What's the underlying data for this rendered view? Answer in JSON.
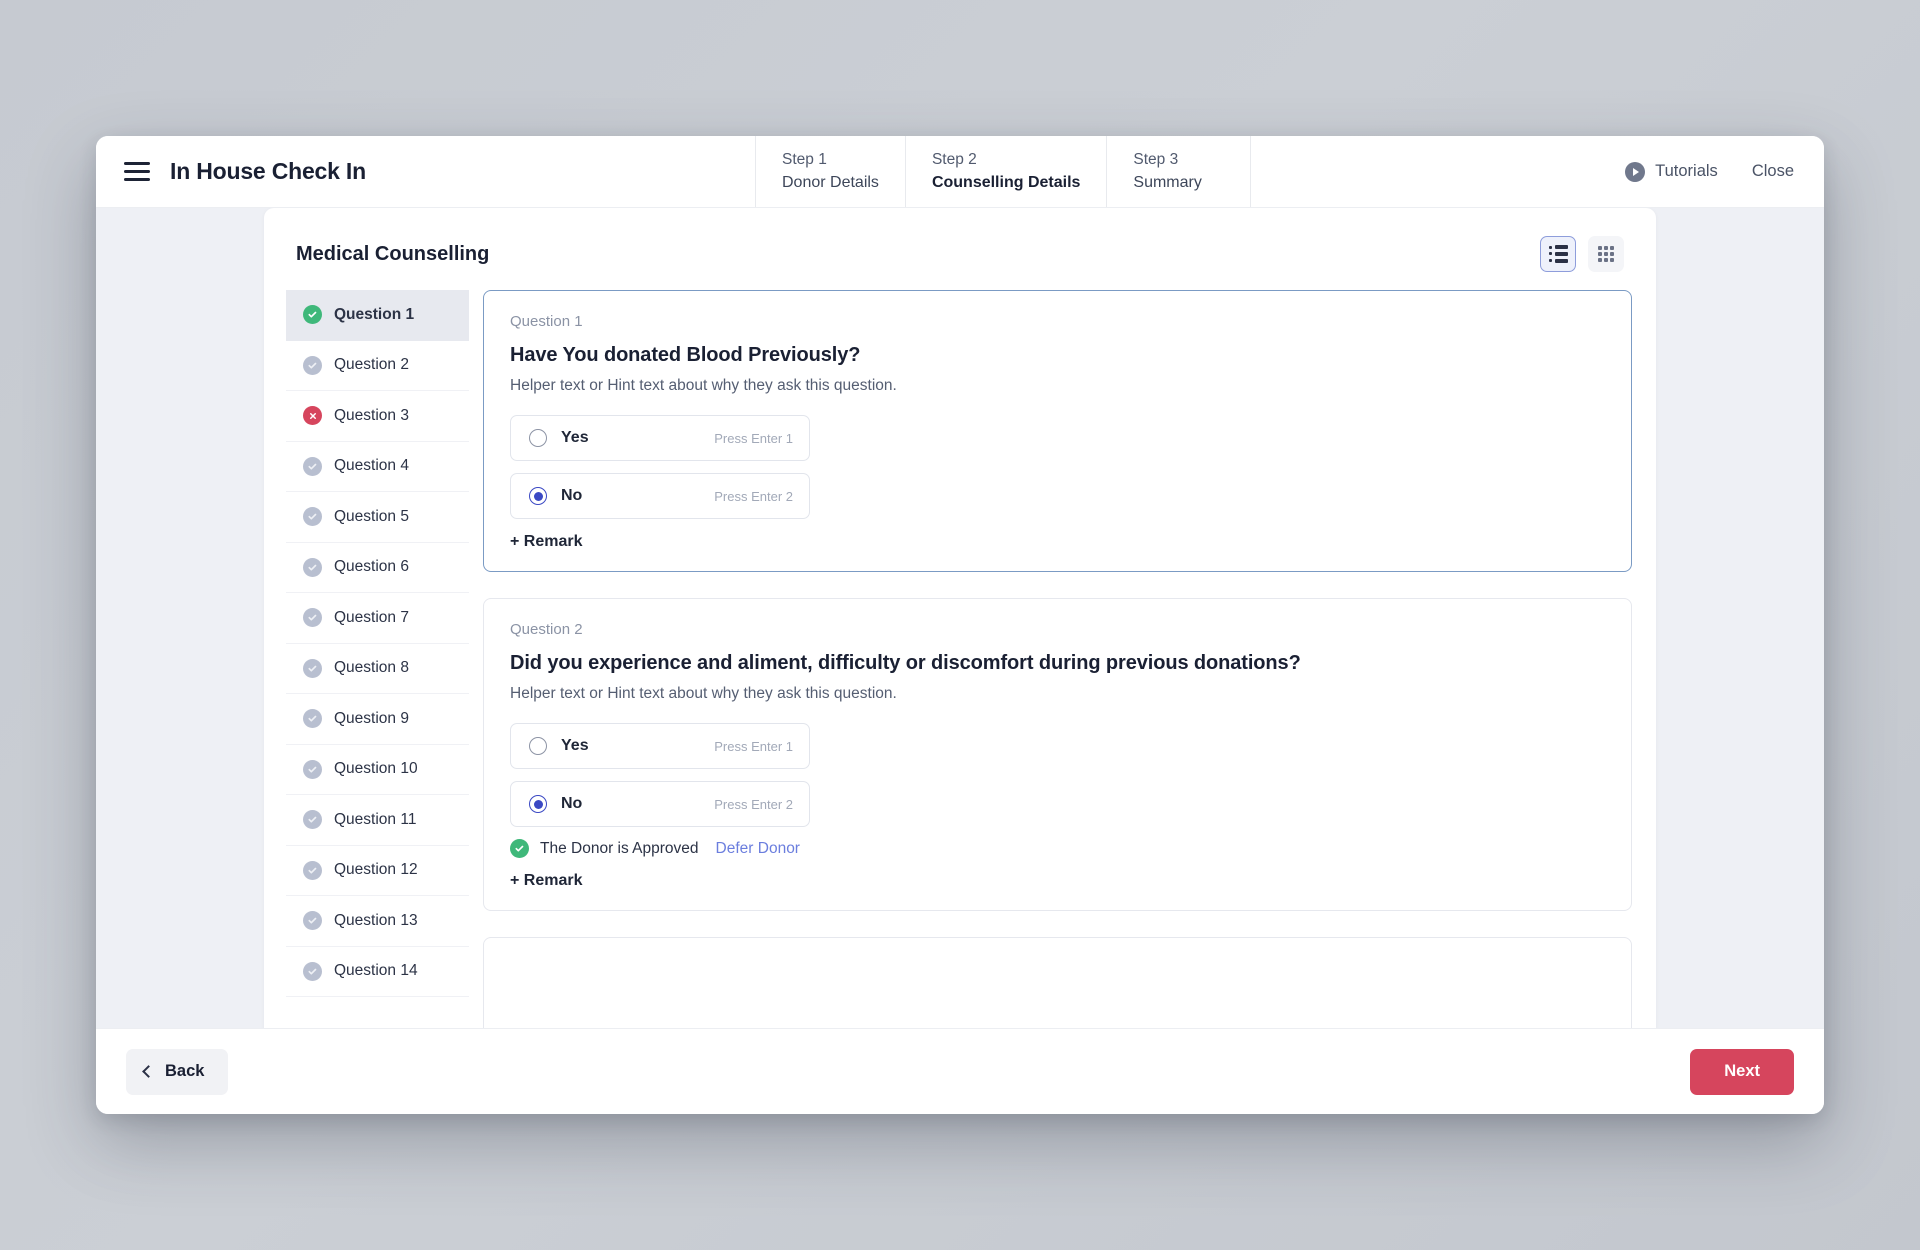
{
  "header": {
    "menu_icon": "hamburger-icon",
    "app_title": "In House Check In",
    "steps": [
      {
        "number": "Step 1",
        "label": "Donor Details",
        "active": false
      },
      {
        "number": "Step 2",
        "label": "Counselling Details",
        "active": true
      },
      {
        "number": "Step 3",
        "label": "Summary",
        "active": false
      }
    ],
    "tutorials_label": "Tutorials",
    "tutorials_icon": "play-circle-icon",
    "close_label": "Close"
  },
  "panel": {
    "title": "Medical Counselling",
    "view_toggle": {
      "list_icon": "list-view-icon",
      "grid_icon": "grid-view-icon",
      "active": "list"
    }
  },
  "sidebar": {
    "items": [
      {
        "label": "Question 1",
        "status": "ok",
        "active": true
      },
      {
        "label": "Question 2",
        "status": "mut",
        "active": false
      },
      {
        "label": "Question 3",
        "status": "err",
        "active": false
      },
      {
        "label": "Question 4",
        "status": "mut",
        "active": false
      },
      {
        "label": "Question 5",
        "status": "mut",
        "active": false
      },
      {
        "label": "Question 6",
        "status": "mut",
        "active": false
      },
      {
        "label": "Question 7",
        "status": "mut",
        "active": false
      },
      {
        "label": "Question 8",
        "status": "mut",
        "active": false
      },
      {
        "label": "Question 9",
        "status": "mut",
        "active": false
      },
      {
        "label": "Question 10",
        "status": "mut",
        "active": false
      },
      {
        "label": "Question 11",
        "status": "mut",
        "active": false
      },
      {
        "label": "Question 12",
        "status": "mut",
        "active": false
      },
      {
        "label": "Question 13",
        "status": "mut",
        "active": false
      },
      {
        "label": "Question 14",
        "status": "mut",
        "active": false
      }
    ]
  },
  "questions": [
    {
      "index_label": "Question 1",
      "text": "Have You donated Blood Previously?",
      "hint": "Helper text or Hint text about why they ask this question.",
      "active": true,
      "options": [
        {
          "label": "Yes",
          "hint": "Press Enter 1",
          "selected": false
        },
        {
          "label": "No",
          "hint": "Press Enter 2",
          "selected": true
        }
      ],
      "approval": null,
      "remark_label": "+ Remark"
    },
    {
      "index_label": "Question 2",
      "text": "Did you experience and aliment, difficulty or discomfort during previous donations?",
      "hint": "Helper text or Hint text about why they ask this question.",
      "active": false,
      "options": [
        {
          "label": "Yes",
          "hint": "Press Enter 1",
          "selected": false
        },
        {
          "label": "No",
          "hint": "Press Enter 2",
          "selected": true
        }
      ],
      "approval": {
        "status_icon": "check-circle-icon",
        "text": "The Donor is Approved",
        "action_label": "Defer Donor"
      },
      "remark_label": "+ Remark"
    }
  ],
  "footer": {
    "back_label": "Back",
    "back_icon": "chevron-left-icon",
    "next_label": "Next"
  },
  "colors": {
    "accent_red": "#d6455d",
    "accent_blue": "#3b49c4",
    "link_blue": "#6b7ede",
    "success_green": "#3fb87a",
    "muted_gray": "#b8bfd0",
    "active_card_border": "#7b9bc4",
    "page_bg": "#eef0f5"
  }
}
